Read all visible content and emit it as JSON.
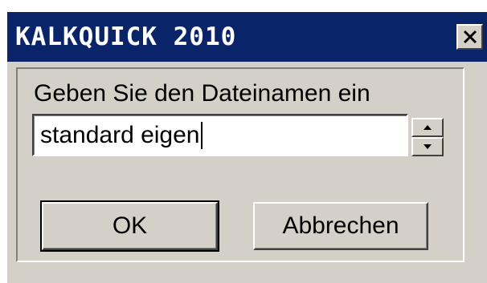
{
  "window": {
    "title": "KALKQUICK 2010",
    "close_icon": "close-icon"
  },
  "dialog": {
    "prompt": "Geben Sie den Dateinamen ein",
    "filename_input": {
      "value": "standard eigen"
    },
    "spinner": {
      "up_icon": "arrow-up-icon",
      "down_icon": "arrow-down-icon"
    },
    "ok_label": "OK",
    "cancel_label": "Abbrechen"
  },
  "colors": {
    "titlebar": "#0a246a",
    "face": "#d4d0c8"
  }
}
